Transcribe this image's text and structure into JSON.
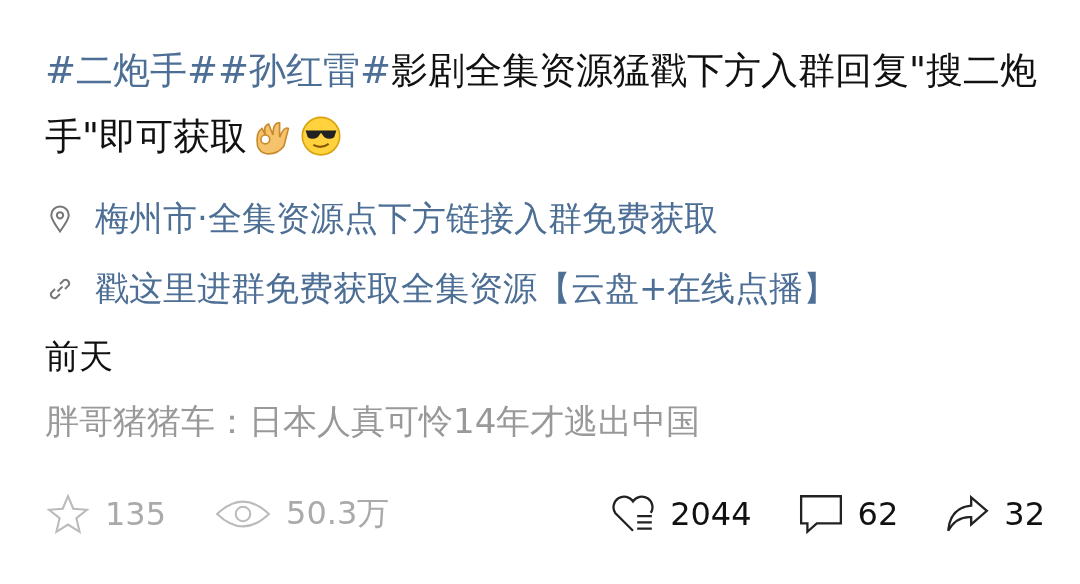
{
  "post": {
    "segments": [
      {
        "kind": "topic",
        "text": "#二炮手#"
      },
      {
        "kind": "topic",
        "text": "#孙红雷#"
      },
      {
        "kind": "plain",
        "text": "影剧全集资源猛戳下方入群回复\"搜二炮手\"即可获取"
      }
    ],
    "emojis": [
      {
        "kind": "ok-hand"
      },
      {
        "kind": "sunglasses"
      }
    ]
  },
  "location": "梅州市·全集资源点下方链接入群免费获取",
  "link": "戳这里进群免费获取全集资源【云盘+在线点播】",
  "time": "前天",
  "quote": "胖哥猪猪车：日本人真可怜14年才逃出中国",
  "stats": [
    {
      "kind": "star",
      "count": "135"
    },
    {
      "kind": "eye",
      "count": "50.3万"
    },
    {
      "kind": "like",
      "count": "2044"
    },
    {
      "kind": "comment",
      "count": "62"
    },
    {
      "kind": "share",
      "count": "32"
    }
  ]
}
